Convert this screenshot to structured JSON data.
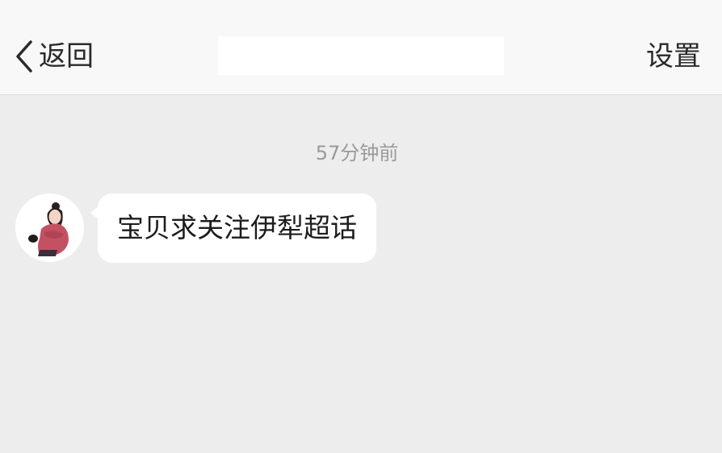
{
  "nav": {
    "back_label": "返回",
    "back_icon": "chevron-left-icon",
    "title": "",
    "settings_label": "设置"
  },
  "chat": {
    "timestamp": "57分钟前",
    "messages": [
      {
        "avatar": "avatar-illustration-woman-pink-sweater",
        "text": "宝贝求关注伊犁超话"
      }
    ]
  },
  "colors": {
    "background": "#ededed",
    "nav_background": "#f8f8f8",
    "bubble": "#ffffff",
    "timestamp_text": "#9a9a9a",
    "avatar_sweater": "#c45163"
  }
}
